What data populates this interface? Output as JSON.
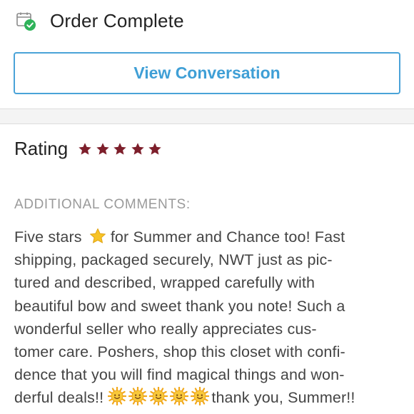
{
  "header": {
    "icon": "order-complete-icon",
    "title": "Order Complete"
  },
  "actions": {
    "view_conversation_label": "View Conversation"
  },
  "rating": {
    "label": "Rating",
    "stars": 5,
    "max_stars": 5,
    "star_color": "#7d1f2b"
  },
  "comments": {
    "heading": "ADDITIONAL COMMENTS:",
    "lines": [
      {
        "before": "Five stars",
        "emoji": "star-emoji",
        "after": "for Summer and Chance too! Fast"
      },
      {
        "text": "shipping, packaged securely, NWT just as pic-"
      },
      {
        "text": "tured and described, wrapped carefully with"
      },
      {
        "text": "beautiful bow and sweet thank you note! Such a"
      },
      {
        "text": "wonderful seller who really appreciates cus-"
      },
      {
        "text": "tomer care. Poshers, shop this closet with confi-"
      },
      {
        "text": "dence that you will find magical things and won-"
      },
      {
        "before": "derful deals!!",
        "emoji": "sun-with-face-emoji",
        "emoji_count": 5,
        "after": "thank you, Summer!!"
      }
    ]
  },
  "colors": {
    "accent_blue": "#3f9fd6",
    "check_green": "#2fb35a",
    "heading_gray": "#9a9a9a",
    "text_dark": "#444444"
  }
}
